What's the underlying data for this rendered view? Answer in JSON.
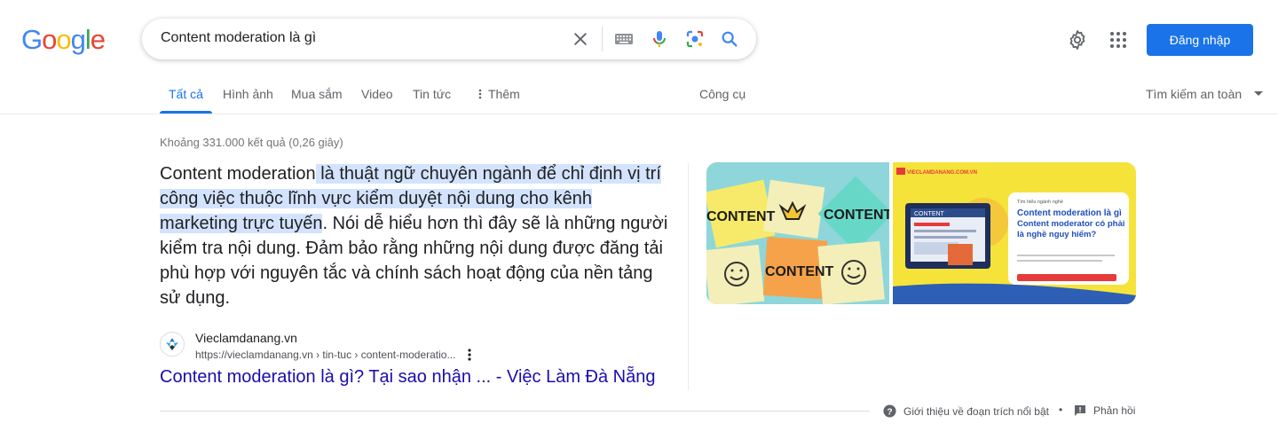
{
  "logo": {
    "letters": [
      "G",
      "o",
      "o",
      "g",
      "l",
      "e"
    ],
    "colors": [
      "#4285f4",
      "#ea4335",
      "#fbbc05",
      "#4285f4",
      "#34a853",
      "#ea4335"
    ]
  },
  "search": {
    "query": "Content moderation là gì"
  },
  "header": {
    "signin_label": "Đăng nhập"
  },
  "tabs": [
    {
      "label": "Tất cả",
      "active": true
    },
    {
      "label": "Hình ảnh"
    },
    {
      "label": "Mua sắm"
    },
    {
      "label": "Video"
    },
    {
      "label": "Tin tức"
    },
    {
      "label": "Thêm"
    }
  ],
  "tools_label": "Công cụ",
  "safesearch_label": "Tìm kiếm an toàn",
  "stats": "Khoảng 331.000 kết quả (0,26 giây)",
  "snippet": {
    "lead": "Content moderation",
    "highlight": " là thuật ngữ chuyên ngành để chỉ định vị trí công việc thuộc lĩnh vực kiểm duyệt nội dung cho kênh marketing trực tuyến",
    "rest": ". Nói dễ hiểu hơn thì đây sẽ là những người kiểm tra nội dung. Đảm bảo rằng những nội dung được đăng tải phù hợp với nguyên tắc và chính sách hoạt động của nền tảng sử dụng."
  },
  "images": {
    "img1_notes": [
      "CONTENT",
      "CONTENT",
      "CONTENT"
    ],
    "img2_site": "VIECLAMDANANG.COM.VN",
    "img2_kicker": "Tìm hiểu ngành nghề",
    "img2_heading_line1": "Content moderation là gì",
    "img2_heading_line2": "Content moderator có phải",
    "img2_heading_line3": "là nghề nguy hiểm?",
    "img2_tag": "CONTENT"
  },
  "result": {
    "site_name": "Vieclamdanang.vn",
    "url": "https://vieclamdanang.vn › tin-tuc › content-moderatio...",
    "title": "Content moderation là gì? Tại sao nhận ... - Việc Làm Đà Nẵng"
  },
  "footer": {
    "about_label": "Giới thiệu về đoạn trích nổi bật",
    "dot": "•",
    "feedback_label": "Phản hồi"
  },
  "colors": {
    "accent": "#1a73e8",
    "link": "#1a0dab",
    "highlight": "#d3e3fd"
  }
}
